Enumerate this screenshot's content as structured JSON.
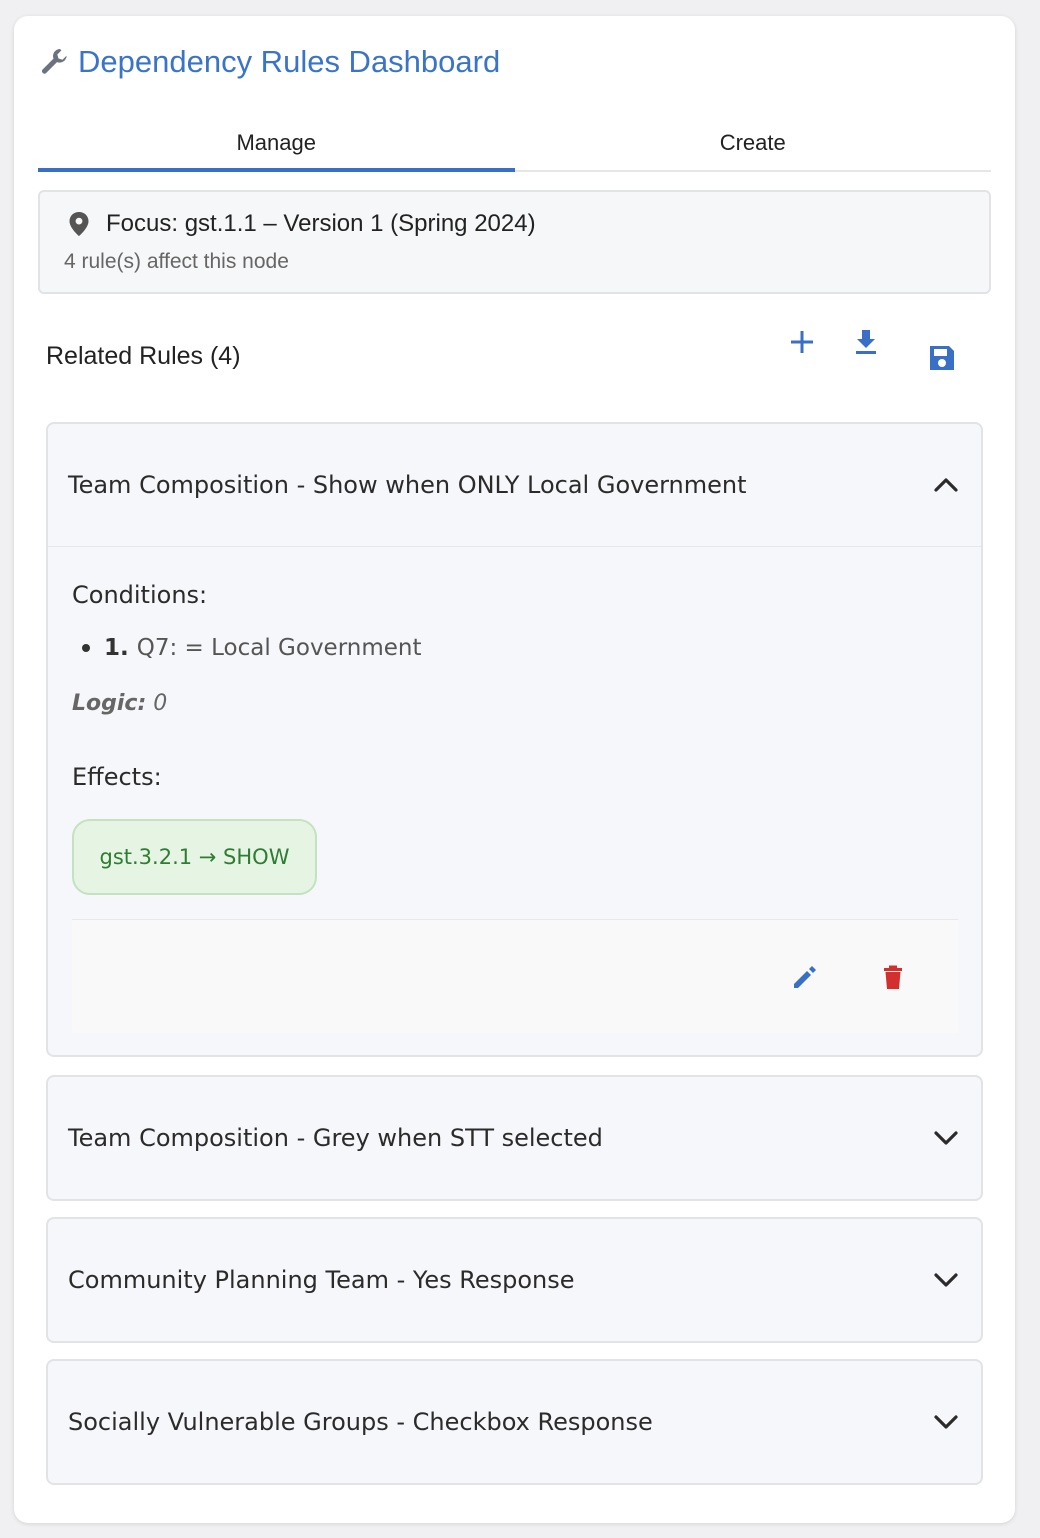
{
  "header": {
    "title": "Dependency Rules Dashboard",
    "icon": "wrench-icon"
  },
  "tabs": [
    {
      "label": "Manage",
      "active": true
    },
    {
      "label": "Create",
      "active": false
    }
  ],
  "focus": {
    "title": "Focus: gst.1.1 – Version 1 (Spring 2024)",
    "subtitle": "4 rule(s) affect this node",
    "icon": "location-pin-icon"
  },
  "related": {
    "title": "Related Rules (4)",
    "toolbar": {
      "add_icon": "plus-icon",
      "download_icon": "download-icon",
      "save_icon": "save-icon"
    }
  },
  "rules": [
    {
      "title": "Team Composition - Show when ONLY Local Government",
      "expanded": true,
      "conditions_label": "Conditions:",
      "conditions": [
        {
          "num": "1.",
          "text": "Q7: = Local Government"
        }
      ],
      "logic_label": "Logic:",
      "logic_value": "0",
      "effects_label": "Effects:",
      "effects": [
        "gst.3.2.1 → SHOW"
      ]
    },
    {
      "title": "Team Composition - Grey when STT selected",
      "expanded": false
    },
    {
      "title": "Community Planning Team - Yes Response",
      "expanded": false
    },
    {
      "title": "Socially Vulnerable Groups - Checkbox Response",
      "expanded": false
    }
  ],
  "colors": {
    "accent": "#3a74c9",
    "effect_text": "#2e7d32",
    "delete": "#d32f2f"
  }
}
